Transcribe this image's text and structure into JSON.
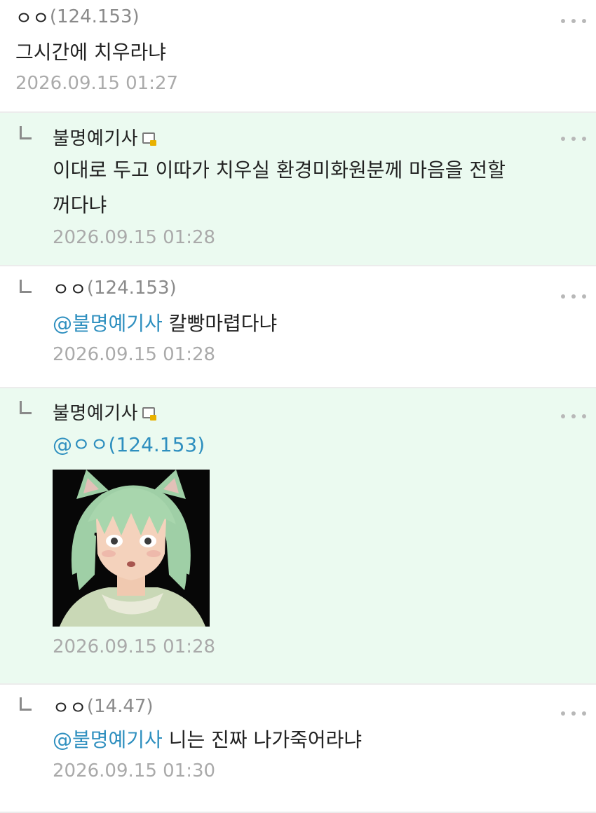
{
  "comments": [
    {
      "nick": "ㅇㅇ",
      "ip": "(124.153)",
      "text": "그시간에 치우라냐",
      "date": "2026.09.15 01:27"
    },
    {
      "nick": "불명예기사",
      "text": "이대로 두고 이따가 치우실 환경미화원분께 마음을 전할꺼다냐",
      "date": "2026.09.15 01:28"
    },
    {
      "nick": "ㅇㅇ",
      "ip": "(124.153)",
      "mention": "@불명예기사",
      "text": "칼빵마렵다냐",
      "date": "2026.09.15 01:28"
    },
    {
      "nick": "불명예기사",
      "mention": "@ㅇㅇ(124.153)",
      "date": "2026.09.15 01:28"
    },
    {
      "nick": "ㅇㅇ",
      "ip": "(14.47)",
      "mention": "@불명예기사",
      "text": "니는 진짜 나가죽어라냐",
      "date": "2026.09.15 01:30"
    }
  ],
  "icons": {
    "fixed_nick": "fixed-nickname-icon",
    "more": "more-options-icon",
    "reply": "reply-arrow-icon"
  },
  "colors": {
    "highlight_bg": "#ebfaf0",
    "mention": "#2e8fbf",
    "meta": "#aaaaaa"
  }
}
